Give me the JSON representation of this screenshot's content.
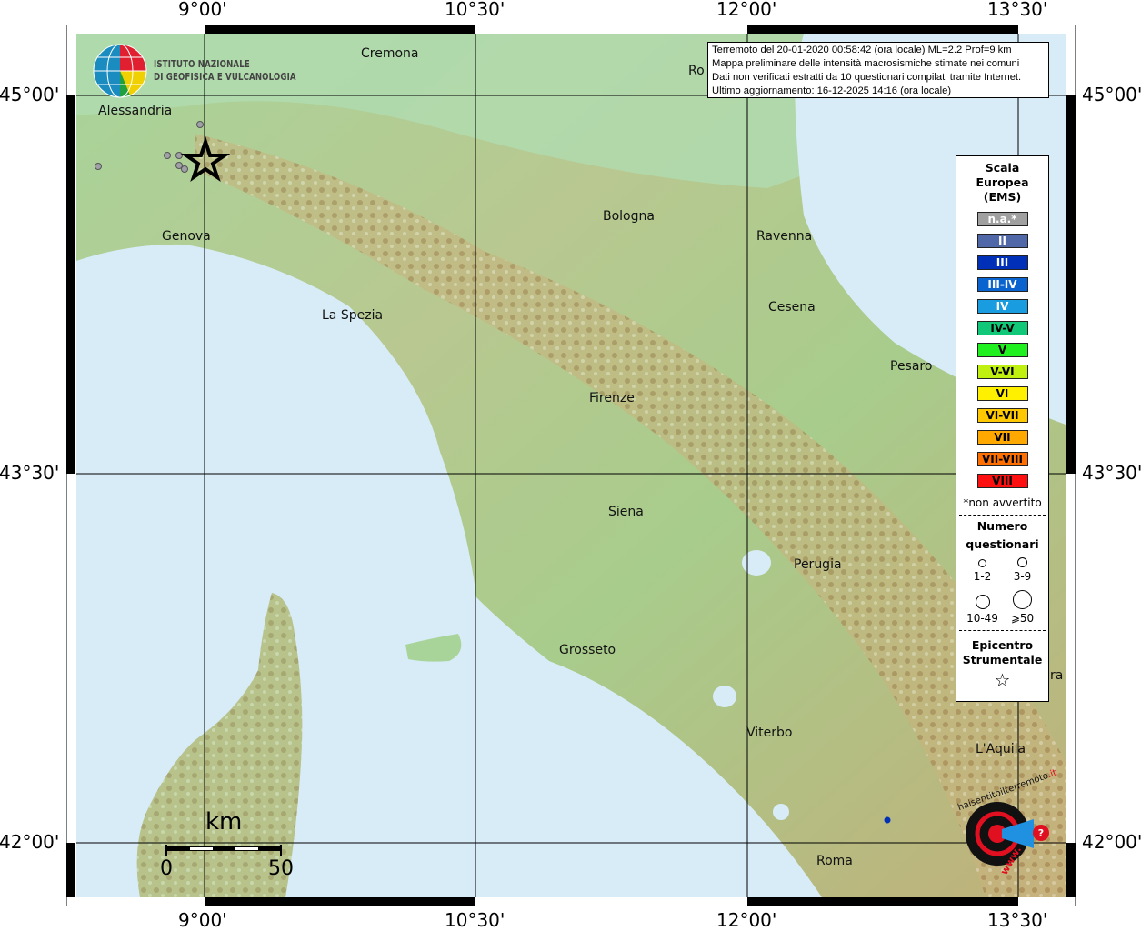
{
  "ticks": {
    "top": [
      "9°00'",
      "10°30'",
      "12°00'",
      "13°30'"
    ],
    "bottom": [
      "9°00'",
      "10°30'",
      "12°00'",
      "13°30'"
    ],
    "left": [
      "45°00'",
      "43°30'",
      "42°00'"
    ],
    "right": [
      "45°00'",
      "43°30'",
      "42°00'"
    ]
  },
  "info": {
    "line1": "Terremoto del 20-01-2020 00:58:42 (ora locale) ML=2.2 Prof=9 km",
    "line2": "Mappa preliminare delle intensità macrosismiche stimate nei comuni",
    "line3": "Dati non verificati estratti da 10 questionari compilati tramite Internet.",
    "line4": "Ultimo aggiornamento: 16-12-2025 14:16 (ora locale)"
  },
  "ingv_logo": {
    "line1": "ISTITUTO NAZIONALE",
    "line2": "DI GEOFISICA E VULCANOLOGIA"
  },
  "cities": [
    "Cremona",
    "Alessandria",
    "Genova",
    "La Spezia",
    "Bologna",
    "Ravenna",
    "Cesena",
    "Pesaro",
    "Firenze",
    "Siena",
    "Perugia",
    "Grosseto",
    "Viterbo",
    "L'Aquila",
    "Roma",
    "Ro",
    "ra"
  ],
  "legend": {
    "title": "Scala Europea (EMS)",
    "title_lines": [
      "Scala",
      "Europea",
      "(EMS)"
    ],
    "classes": [
      {
        "label": "n.a.*",
        "color": "#a0a0a0",
        "text": "#ffffff"
      },
      {
        "label": "II",
        "color": "#5068a8",
        "text": "#ffffff"
      },
      {
        "label": "III",
        "color": "#0030b8",
        "text": "#ffffff"
      },
      {
        "label": "III-IV",
        "color": "#0a64d0",
        "text": "#ffffff"
      },
      {
        "label": "IV",
        "color": "#1a9ce0",
        "text": "#ffffff"
      },
      {
        "label": "IV-V",
        "color": "#10c878",
        "text": "#000000"
      },
      {
        "label": "V",
        "color": "#20f020",
        "text": "#000000"
      },
      {
        "label": "V-VI",
        "color": "#c0f010",
        "text": "#000000"
      },
      {
        "label": "VI",
        "color": "#fff000",
        "text": "#000000"
      },
      {
        "label": "VI-VII",
        "color": "#ffc800",
        "text": "#000000"
      },
      {
        "label": "VII",
        "color": "#ffa800",
        "text": "#000000"
      },
      {
        "label": "VII-VIII",
        "color": "#ff7000",
        "text": "#000000"
      },
      {
        "label": "VIII",
        "color": "#ff1010",
        "text": "#000000"
      }
    ],
    "footnote": "*non avvertito",
    "count_title": [
      "Numero",
      "questionari"
    ],
    "counts": [
      "1-2",
      "3-9",
      "10-49",
      "⩾50"
    ],
    "epicenter_title": [
      "Epicentro",
      "Strumentale"
    ],
    "epicenter_icon": "star-outline-icon"
  },
  "scale_bar": {
    "unit": "km",
    "start": "0",
    "end": "50"
  },
  "hsit_logo": {
    "text_top": "haisentitoilterremoto",
    "text_it": ".it",
    "text_www": "www."
  },
  "colors": {
    "sea": "#d8ecf8",
    "lowland": "#9fd09a",
    "hills": "#c8c890",
    "mountains": "#b89060",
    "questionnaire_point": "#a0a0a8"
  }
}
